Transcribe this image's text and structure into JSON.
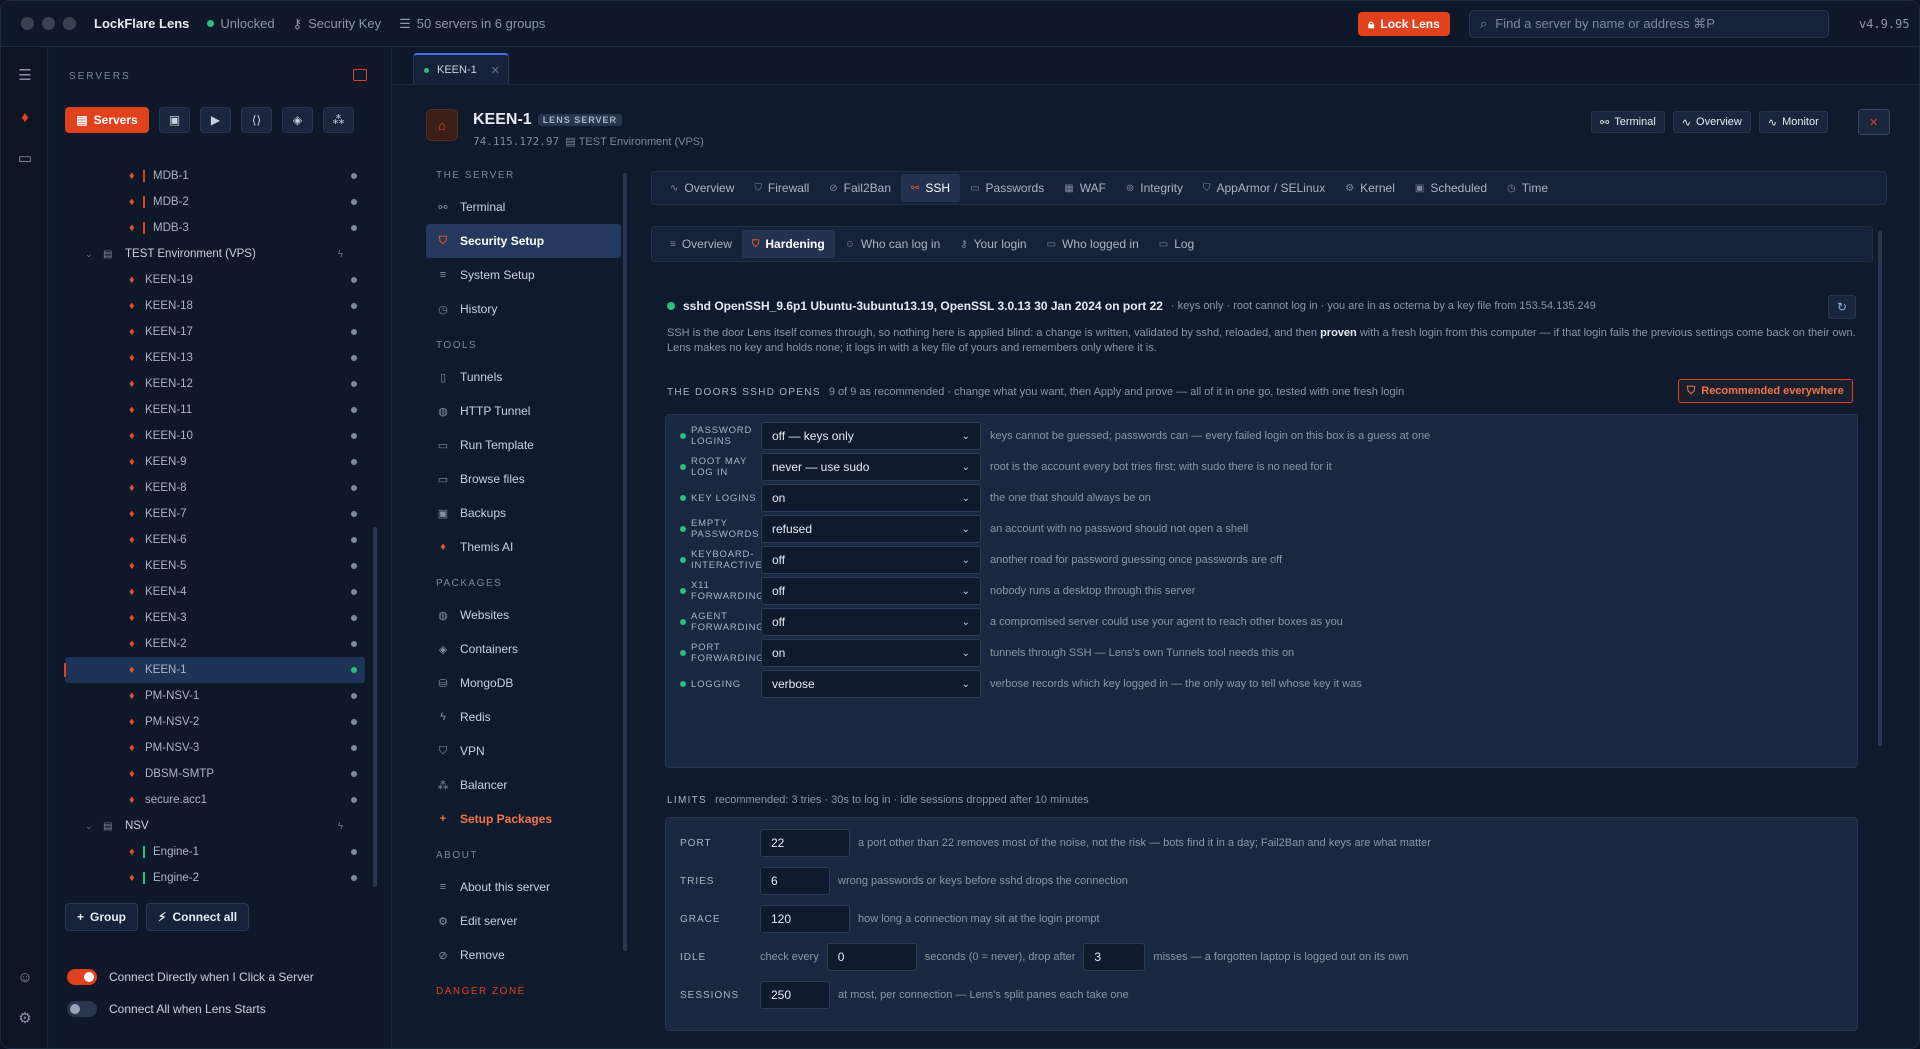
{
  "titlebar": {
    "app_name": "LockFlare Lens",
    "status": "Unlocked",
    "security_key": "Security Key",
    "servers_summary": "50 servers in 6 groups",
    "lock_button": "Lock Lens",
    "search_placeholder": "Find a server by name or address  ⌘P",
    "version": "v4.9.95"
  },
  "sidebar": {
    "heading": "SERVERS",
    "servers_button": "Servers",
    "tree": [
      {
        "label": "MDB-1",
        "type": "server",
        "bar": "red"
      },
      {
        "label": "MDB-2",
        "type": "server",
        "bar": "red"
      },
      {
        "label": "MDB-3",
        "type": "server",
        "bar": "red"
      },
      {
        "label": "TEST Environment (VPS)",
        "type": "group"
      },
      {
        "label": "KEEN-19",
        "type": "server"
      },
      {
        "label": "KEEN-18",
        "type": "server"
      },
      {
        "label": "KEEN-17",
        "type": "server"
      },
      {
        "label": "KEEN-13",
        "type": "server"
      },
      {
        "label": "KEEN-12",
        "type": "server"
      },
      {
        "label": "KEEN-11",
        "type": "server"
      },
      {
        "label": "KEEN-10",
        "type": "server"
      },
      {
        "label": "KEEN-9",
        "type": "server"
      },
      {
        "label": "KEEN-8",
        "type": "server"
      },
      {
        "label": "KEEN-7",
        "type": "server"
      },
      {
        "label": "KEEN-6",
        "type": "server"
      },
      {
        "label": "KEEN-5",
        "type": "server"
      },
      {
        "label": "KEEN-4",
        "type": "server"
      },
      {
        "label": "KEEN-3",
        "type": "server"
      },
      {
        "label": "KEEN-2",
        "type": "server"
      },
      {
        "label": "KEEN-1",
        "type": "server",
        "selected": true
      },
      {
        "label": "PM-NSV-1",
        "type": "server"
      },
      {
        "label": "PM-NSV-2",
        "type": "server"
      },
      {
        "label": "PM-NSV-3",
        "type": "server"
      },
      {
        "label": "DBSM-SMTP",
        "type": "server"
      },
      {
        "label": "secure.acc1",
        "type": "server"
      },
      {
        "label": "NSV",
        "type": "group"
      },
      {
        "label": "Engine-1",
        "type": "server",
        "bar": "green"
      },
      {
        "label": "Engine-2",
        "type": "server",
        "bar": "green"
      }
    ],
    "group_button": "Group",
    "connect_all_button": "Connect all",
    "toggle_connect_click": "Connect Directly when I Click a Server",
    "toggle_connect_start": "Connect All when Lens Starts"
  },
  "tab": {
    "label": "KEEN-1"
  },
  "server": {
    "name": "KEEN-1",
    "badge": "LENS SERVER",
    "address": "74.115.172.97",
    "group": "TEST Environment (VPS)",
    "buttons": {
      "terminal": "Terminal",
      "overview": "Overview",
      "monitor": "Monitor"
    }
  },
  "nav": {
    "the_server": "THE SERVER",
    "terminal": "Terminal",
    "security_setup": "Security Setup",
    "system_setup": "System Setup",
    "history": "History",
    "tools": "TOOLS",
    "tunnels": "Tunnels",
    "http_tunnel": "HTTP Tunnel",
    "run_template": "Run Template",
    "browse_files": "Browse files",
    "backups": "Backups",
    "themis_ai": "Themis AI",
    "packages": "PACKAGES",
    "websites": "Websites",
    "containers": "Containers",
    "mongodb": "MongoDB",
    "redis": "Redis",
    "vpn": "VPN",
    "balancer": "Balancer",
    "setup_packages": "Setup Packages",
    "about": "ABOUT",
    "about_server": "About this server",
    "edit_server": "Edit server",
    "remove": "Remove",
    "danger_zone": "DANGER ZONE"
  },
  "tabs": [
    "Overview",
    "Firewall",
    "Fail2Ban",
    "SSH",
    "Passwords",
    "WAF",
    "Integrity",
    "AppArmor / SELinux",
    "Kernel",
    "Scheduled",
    "Time"
  ],
  "subtabs": [
    "Overview",
    "Hardening",
    "Who can log in",
    "Your login",
    "Who logged in",
    "Log"
  ],
  "sshd": {
    "version": "sshd OpenSSH_9.6p1 Ubuntu-3ubuntu13.19, OpenSSL 3.0.13 30 Jan 2024 on port 22",
    "summary": "· keys only · root cannot log in · you are in as octerna by a key file from 153.54.135.249",
    "para_1": "SSH is the door Lens itself comes through, so nothing here is applied blind: a change is written, validated by sshd, reloaded, and then",
    "para_bold": "proven",
    "para_2": "with a fresh login from this computer — if that login fails the previous settings come back on their own. Lens makes no key and holds none; it logs in with a key file of yours and remembers only where it is."
  },
  "doors": {
    "title": "THE DOORS SSHD OPENS",
    "subtitle": "9 of 9 as recommended · change what you want, then Apply and prove — all of it in one go, tested with one fresh login",
    "recommended_button": "Recommended everywhere",
    "rows": [
      {
        "label": "PASSWORD LOGINS",
        "value": "off — keys only",
        "desc": "keys cannot be guessed; passwords can — every failed login on this box is a guess at one"
      },
      {
        "label": "ROOT MAY LOG IN",
        "value": "never — use sudo",
        "desc": "root is the account every bot tries first; with sudo there is no need for it"
      },
      {
        "label": "KEY LOGINS",
        "value": "on",
        "desc": "the one that should always be on"
      },
      {
        "label": "EMPTY PASSWORDS",
        "value": "refused",
        "desc": "an account with no password should not open a shell"
      },
      {
        "label": "KEYBOARD-INTERACTIVE",
        "value": "off",
        "desc": "another road for password guessing once passwords are off"
      },
      {
        "label": "X11 FORWARDING",
        "value": "off",
        "desc": "nobody runs a desktop through this server"
      },
      {
        "label": "AGENT FORWARDING",
        "value": "off",
        "desc": "a compromised server could use your agent to reach other boxes as you"
      },
      {
        "label": "PORT FORWARDING",
        "value": "on",
        "desc": "tunnels through SSH — Lens's own Tunnels tool needs this on"
      },
      {
        "label": "LOGGING",
        "value": "verbose",
        "desc": "verbose records which key logged in — the only way to tell whose key it was"
      }
    ]
  },
  "limits": {
    "title": "LIMITS",
    "subtitle": "recommended: 3 tries · 30s to log in · idle sessions dropped after 10 minutes",
    "port_label": "PORT",
    "port_value": "22",
    "port_desc": "a port other than 22 removes most of the noise, not the risk — bots find it in a day; Fail2Ban and keys are what matter",
    "tries_label": "TRIES",
    "tries_value": "6",
    "tries_desc": "wrong passwords or keys before sshd drops the connection",
    "grace_label": "GRACE",
    "grace_value": "120",
    "grace_desc": "how long a connection may sit at the login prompt",
    "idle_label": "IDLE",
    "idle_check": "check every",
    "idle_value": "0",
    "idle_mid": "seconds (0 = never), drop after",
    "idle_misses": "3",
    "idle_desc": "misses — a forgotten laptop is logged out on its own",
    "sessions_label": "SESSIONS",
    "sessions_value": "250",
    "sessions_desc": "at most, per connection — Lens's split panes each take one"
  }
}
